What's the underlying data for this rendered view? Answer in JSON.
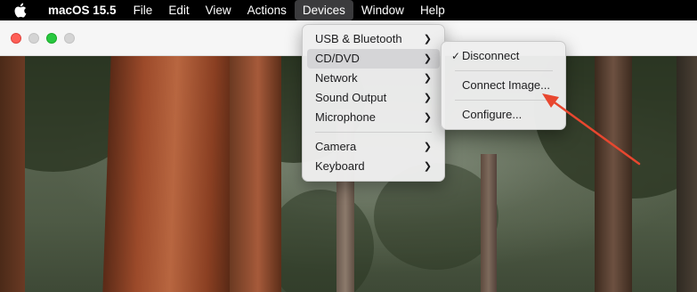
{
  "menubar": {
    "apple_icon": "apple-logo",
    "app_name": "macOS 15.5",
    "items": [
      "File",
      "Edit",
      "View",
      "Actions",
      "Devices",
      "Window",
      "Help"
    ],
    "open_item": "Devices"
  },
  "window": {
    "traffic_lights": [
      "close",
      "minimize-disabled",
      "zoom",
      "extra-disabled"
    ]
  },
  "devices_menu": {
    "group1": [
      {
        "label": "USB & Bluetooth",
        "has_submenu": true
      },
      {
        "label": "CD/DVD",
        "has_submenu": true,
        "highlighted": true
      },
      {
        "label": "Network",
        "has_submenu": true
      },
      {
        "label": "Sound Output",
        "has_submenu": true
      },
      {
        "label": "Microphone",
        "has_submenu": true
      }
    ],
    "group2": [
      {
        "label": "Camera",
        "has_submenu": true
      },
      {
        "label": "Keyboard",
        "has_submenu": true
      }
    ]
  },
  "cddvd_submenu": {
    "check_mark": "✓",
    "items": [
      {
        "label": "Disconnect",
        "checked": true
      },
      {
        "label": "Connect Image..."
      },
      {
        "label": "Configure..."
      }
    ]
  },
  "colors": {
    "annotation_arrow": "#e8472f",
    "menubar_bg": "#000000",
    "highlight": "#d5d5d7"
  }
}
